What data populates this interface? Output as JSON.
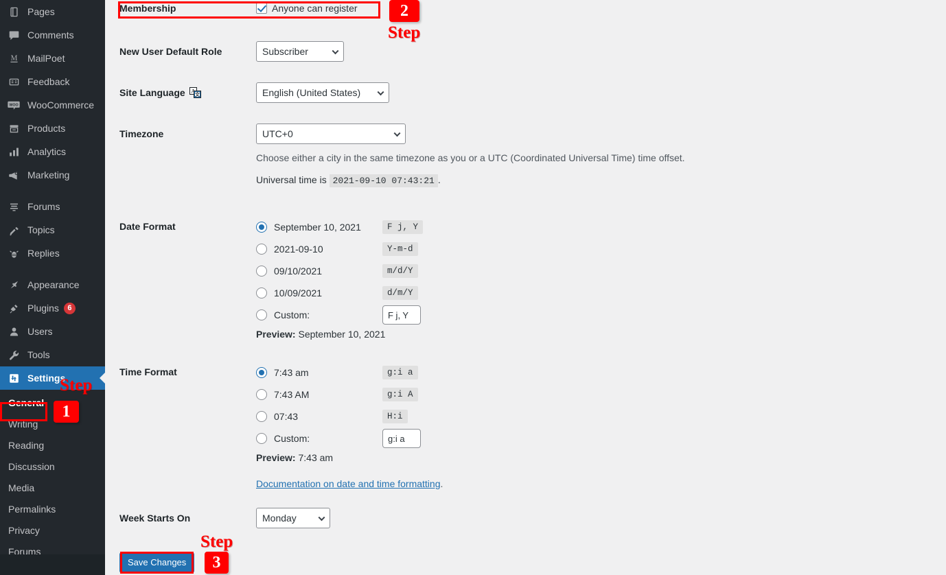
{
  "sidebar": {
    "items": [
      {
        "label": "Pages",
        "icon": "pages-icon",
        "badge": null
      },
      {
        "label": "Comments",
        "icon": "comments-icon",
        "badge": null
      },
      {
        "label": "MailPoet",
        "icon": "mailpoet-icon",
        "badge": null
      },
      {
        "label": "Feedback",
        "icon": "feedback-icon",
        "badge": null
      },
      {
        "label": "WooCommerce",
        "icon": "woocommerce-icon",
        "badge": null
      },
      {
        "label": "Products",
        "icon": "products-icon",
        "badge": null
      },
      {
        "label": "Analytics",
        "icon": "analytics-icon",
        "badge": null
      },
      {
        "label": "Marketing",
        "icon": "marketing-icon",
        "badge": null
      },
      {
        "label": "Forums",
        "icon": "forums-icon",
        "badge": null
      },
      {
        "label": "Topics",
        "icon": "topics-icon",
        "badge": null
      },
      {
        "label": "Replies",
        "icon": "replies-icon",
        "badge": null
      },
      {
        "label": "Appearance",
        "icon": "appearance-icon",
        "badge": null
      },
      {
        "label": "Plugins",
        "icon": "plugins-icon",
        "badge": "6"
      },
      {
        "label": "Users",
        "icon": "users-icon",
        "badge": null
      },
      {
        "label": "Tools",
        "icon": "tools-icon",
        "badge": null
      },
      {
        "label": "Settings",
        "icon": "settings-icon",
        "badge": null
      }
    ],
    "settings_submenu": [
      "General",
      "Writing",
      "Reading",
      "Discussion",
      "Media",
      "Permalinks",
      "Privacy",
      "Forums"
    ],
    "current_item": "Settings",
    "current_subitem": "General"
  },
  "settings": {
    "membership": {
      "label": "Membership",
      "checkbox_label": "Anyone can register",
      "checked": true
    },
    "new_user_default_role": {
      "label": "New User Default Role",
      "value": "Subscriber"
    },
    "site_language": {
      "label": "Site Language",
      "icon": "translation-icon",
      "value": "English (United States)"
    },
    "timezone": {
      "label": "Timezone",
      "value": "UTC+0",
      "description": "Choose either a city in the same timezone as you or a UTC (Coordinated Universal Time) time offset.",
      "universal_time_prefix": "Universal time is",
      "universal_time": "2021-09-10 07:43:21",
      "universal_time_suffix": "."
    },
    "date_format": {
      "label": "Date Format",
      "options": [
        {
          "text": "September 10, 2021",
          "code": "F j, Y",
          "selected": true,
          "custom": false
        },
        {
          "text": "2021-09-10",
          "code": "Y-m-d",
          "selected": false,
          "custom": false
        },
        {
          "text": "09/10/2021",
          "code": "m/d/Y",
          "selected": false,
          "custom": false
        },
        {
          "text": "10/09/2021",
          "code": "d/m/Y",
          "selected": false,
          "custom": false
        },
        {
          "text": "Custom:",
          "code": "F j, Y",
          "selected": false,
          "custom": true
        }
      ],
      "preview_label": "Preview:",
      "preview_value": "September 10, 2021"
    },
    "time_format": {
      "label": "Time Format",
      "options": [
        {
          "text": "7:43 am",
          "code": "g:i a",
          "selected": true,
          "custom": false
        },
        {
          "text": "7:43 AM",
          "code": "g:i A",
          "selected": false,
          "custom": false
        },
        {
          "text": "07:43",
          "code": "H:i",
          "selected": false,
          "custom": false
        },
        {
          "text": "Custom:",
          "code": "g:i a",
          "selected": false,
          "custom": true
        }
      ],
      "preview_label": "Preview:",
      "preview_value": "7:43 am",
      "doc_link": "Documentation on date and time formatting",
      "doc_link_suffix": "."
    },
    "week_starts_on": {
      "label": "Week Starts On",
      "value": "Monday"
    },
    "save_button": "Save Changes"
  },
  "annotations": {
    "step_word": "Step",
    "step1": "1",
    "step2": "2",
    "step3": "3",
    "highlight_color": "#ff0000"
  }
}
